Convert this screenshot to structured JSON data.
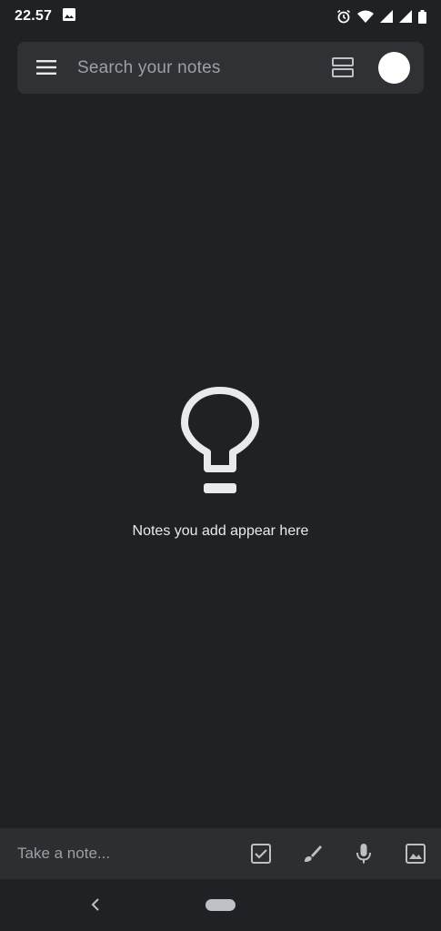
{
  "status_bar": {
    "time": "22.57",
    "icons": [
      "image-icon",
      "alarm-icon",
      "wifi-icon",
      "signal-icon",
      "signal-icon",
      "battery-icon"
    ]
  },
  "search": {
    "placeholder": "Search your notes",
    "icons": [
      "menu-icon",
      "layout-toggle-icon",
      "avatar"
    ]
  },
  "empty_state": {
    "icon": "lightbulb-icon",
    "text": "Notes you add appear here"
  },
  "bottom_bar": {
    "placeholder": "Take a note...",
    "icons": [
      "checkbox-icon",
      "brush-icon",
      "mic-icon",
      "image-icon"
    ]
  },
  "nav": {
    "icons": [
      "back-icon",
      "home-pill"
    ]
  },
  "colors": {
    "background": "#202124",
    "surface": "#303134",
    "bottom_bar": "#2d2e30",
    "text_secondary": "#9aa0a6",
    "text_primary": "#e8eaed"
  }
}
